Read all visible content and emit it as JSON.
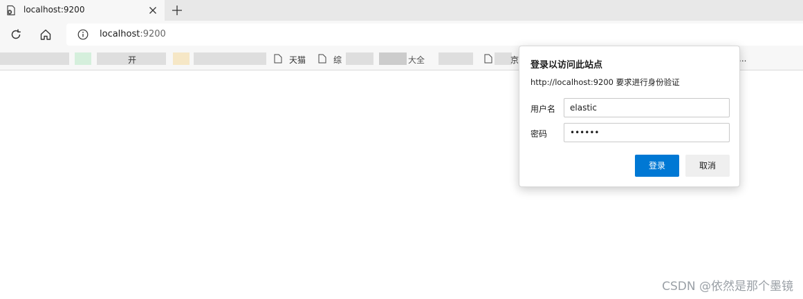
{
  "tab": {
    "title": "localhost:9200",
    "icon": "page-icon"
  },
  "toolbar": {
    "url_host": "localhost",
    "url_port": ":9200"
  },
  "favorites": {
    "items": [
      "开",
      "天猫",
      "综",
      "大全",
      "京"
    ],
    "overflow": "..."
  },
  "dialog": {
    "title": "登录以访问此站点",
    "description": "http://localhost:9200 要求进行身份验证",
    "username_label": "用户名",
    "username_value": "elastic",
    "password_label": "密码",
    "password_value": "••••••",
    "login_label": "登录",
    "cancel_label": "取消"
  },
  "watermark": "CSDN @依然是那个墨镜",
  "colors": {
    "accent": "#0078d4",
    "tabstrip": "#e8e8e8",
    "toolbar": "#f7f7f7"
  }
}
